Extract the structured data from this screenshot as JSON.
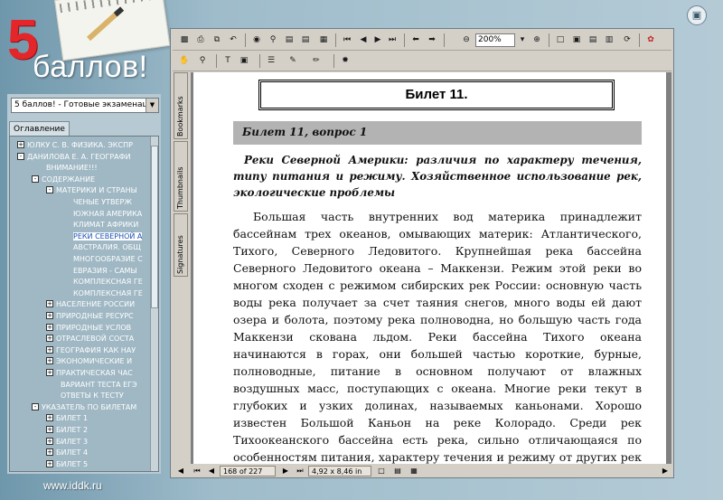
{
  "logo": {
    "number": "5",
    "word": "баллов!"
  },
  "sidebar": {
    "doc_select": "5 баллов! - Готовые экзаменацион",
    "tab": "Оглавление",
    "tree": [
      {
        "exp": "+",
        "label": "ЮЛКУ С. В. ФИЗИКА. ЭКСПР",
        "selected": false
      },
      {
        "exp": "-",
        "label": "ДАНИЛОВА Е. А. ГЕОГРАФИ",
        "selected": false
      },
      {
        "exp": "",
        "label": "ВНИМАНИЕ!!!",
        "selected": false
      },
      {
        "exp": "-",
        "label": "СОДЕРЖАНИЕ",
        "selected": false
      },
      {
        "exp": "-",
        "label": "МАТЕРИКИ И СТРАНЫ",
        "selected": false
      },
      {
        "exp": "",
        "label": "ЧЕНЫЕ УТВЕРЖ",
        "selected": false
      },
      {
        "exp": "",
        "label": "ЮЖНАЯ АМЕРИКА",
        "selected": false
      },
      {
        "exp": "",
        "label": "КЛИМАТ АФРИКИ",
        "selected": false
      },
      {
        "exp": "",
        "label": "РЕКИ СЕВЕРНОЙ А",
        "selected": true
      },
      {
        "exp": "",
        "label": "АВСТРАЛИЯ. ОБЩ",
        "selected": false
      },
      {
        "exp": "",
        "label": "МНОГООБРАЗИЕ С",
        "selected": false
      },
      {
        "exp": "",
        "label": "ЕВРАЗИЯ - САМЫ",
        "selected": false
      },
      {
        "exp": "",
        "label": "КОМПЛЕКСНАЯ ГЕ",
        "selected": false
      },
      {
        "exp": "",
        "label": "КОМПЛЕКСНАЯ ГЕ",
        "selected": false
      },
      {
        "exp": "+",
        "label": "НАСЕЛЕНИЕ РОССИИ",
        "selected": false
      },
      {
        "exp": "+",
        "label": "ПРИРОДНЫЕ РЕСУРС",
        "selected": false
      },
      {
        "exp": "+",
        "label": "ПРИРОДНЫЕ УСЛОВ",
        "selected": false
      },
      {
        "exp": "+",
        "label": "ОТРАСЛЕВОЙ СОСТА",
        "selected": false
      },
      {
        "exp": "+",
        "label": "ГЕОГРАФИЯ КАК НАУ",
        "selected": false
      },
      {
        "exp": "+",
        "label": "ЭКОНОМИЧЕСКИЕ И",
        "selected": false
      },
      {
        "exp": "+",
        "label": "ПРАКТИЧЕСКАЯ ЧАС",
        "selected": false
      },
      {
        "exp": "",
        "label": "ВАРИАНТ ТЕСТА ЕГЭ",
        "selected": false
      },
      {
        "exp": "",
        "label": "ОТВЕТЫ К ТЕСТУ",
        "selected": false
      },
      {
        "exp": "-",
        "label": "УКАЗАТЕЛЬ ПО БИЛЕТАМ",
        "selected": false
      },
      {
        "exp": "+",
        "label": "БИЛЕТ 1",
        "selected": false
      },
      {
        "exp": "+",
        "label": "БИЛЕТ 2",
        "selected": false
      },
      {
        "exp": "+",
        "label": "БИЛЕТ 3",
        "selected": false
      },
      {
        "exp": "+",
        "label": "БИЛЕТ 4",
        "selected": false
      },
      {
        "exp": "+",
        "label": "БИЛЕТ 5",
        "selected": false
      }
    ]
  },
  "toolbar": {
    "zoom": "200%"
  },
  "side_tabs": {
    "bookmarks": "Bookmarks",
    "thumbnails": "Thumbnails",
    "signatures": "Signatures"
  },
  "page": {
    "ticket_title": "Билет 11.",
    "question_label": "Билет 11, вопрос 1",
    "question_heading": "Реки Северной Америки: различия по характеру течения, типу питания и режиму. Хозяйственное использование рек, экологические проблемы",
    "body": "Большая часть внутренних вод материка принадлежит бассейнам трех океанов, омывающих материк: Атлантического, Тихого, Северного Ледовитого. Крупнейшая река бассейна Северного Ледовитого океана – Маккензи. Режим этой реки во многом сходен с режимом сибирских рек России: основную часть воды река получает за счет таяния снегов, много воды ей дают озера и болота, поэтому река полноводна, но большую часть года Маккензи скована льдом. Реки бассейна Тихого океана начинаются в горах, они большей частью короткие, бурные, полноводные, питание в основном получают от влажных воздушных масс, поступающих с океана. Многие реки текут в глубоких и узких долинах, называемых каньонами. Хорошо известен Большой Каньон на реке Колорадо. Среди рек Тихоокеанского бассейна есть река, сильно отличающаяся по особенностям питания, характеру течения и режиму от других рек этого бассейна. Это Юкон, протекающий на северо-западе материка, с длинным"
  },
  "status": {
    "page": "168 of 227",
    "size": "4,92 x 8,46 in"
  },
  "footer": {
    "url": "www.iddk.ru"
  }
}
